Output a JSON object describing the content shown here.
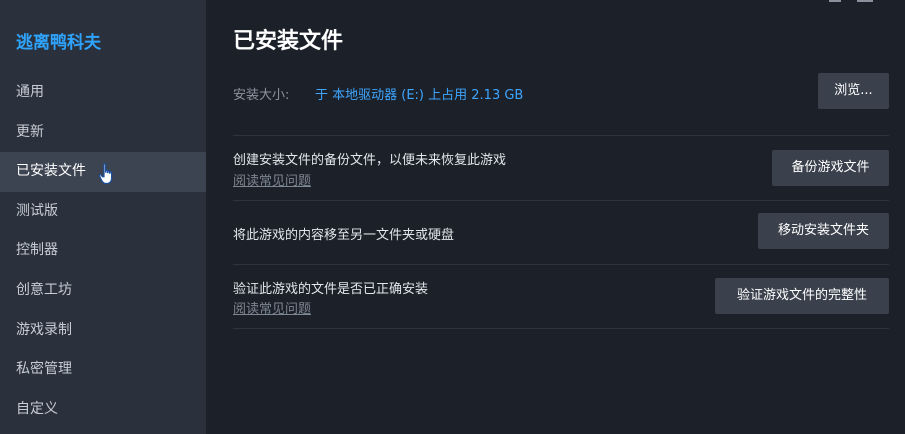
{
  "sidebar": {
    "app_title": "逃离鸭科夫",
    "items": [
      {
        "label": "通用"
      },
      {
        "label": "更新"
      },
      {
        "label": "已安装文件"
      },
      {
        "label": "测试版"
      },
      {
        "label": "控制器"
      },
      {
        "label": "创意工坊"
      },
      {
        "label": "游戏录制"
      },
      {
        "label": "私密管理"
      },
      {
        "label": "自定义"
      }
    ],
    "active_index": 2
  },
  "main": {
    "title": "已安装文件",
    "install_size": {
      "label": "安装大小:",
      "value": "于 本地驱动器 (E:) 上占用 2.13 GB",
      "browse_button": "浏览..."
    },
    "backup": {
      "text": "创建安装文件的备份文件，以便未来恢复此游戏",
      "faq_link": "阅读常见问题",
      "button": "备份游戏文件"
    },
    "move": {
      "text": "将此游戏的内容移至另一文件夹或硬盘",
      "button": "移动安装文件夹"
    },
    "verify": {
      "text": "验证此游戏的文件是否已正确安装",
      "faq_link": "阅读常见问题",
      "button": "验证游戏文件的完整性"
    }
  },
  "colors": {
    "accent": "#2fa4ff",
    "sidebar_bg": "#2a313c",
    "main_bg": "#1b2029",
    "button_bg": "#3a414c"
  }
}
